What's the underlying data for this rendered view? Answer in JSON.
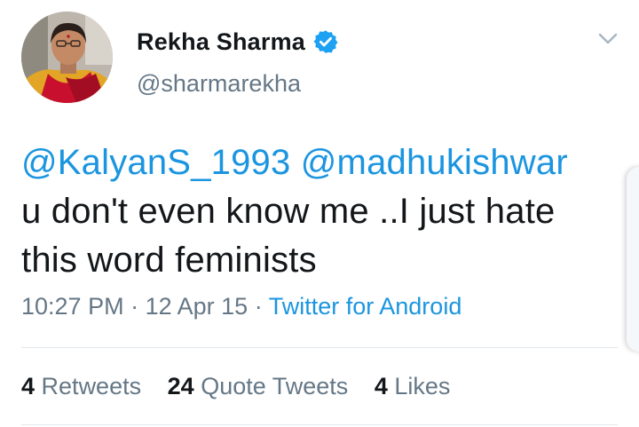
{
  "author": {
    "display_name": "Rekha Sharma",
    "handle": "@sharmarekha",
    "verified": true,
    "verified_icon": "verified-badge-icon",
    "verified_color": "#1da1f2"
  },
  "menu_icon": "chevron-down-icon",
  "tweet": {
    "mention_1": "@KalyanS_1993",
    "mention_2": "@madhukishwar",
    "text_line_1_rest": "u don't even know me ..I just hate",
    "text_line_2": "this word feminists"
  },
  "meta": {
    "time": "10:27 PM",
    "separator": "·",
    "date": "12 Apr 15",
    "source": "Twitter for Android"
  },
  "stats": {
    "retweets_count": "4",
    "retweets_label": "Retweets",
    "quote_count": "24",
    "quote_label": "Quote Tweets",
    "likes_count": "4",
    "likes_label": "Likes"
  },
  "colors": {
    "text": "#14171a",
    "secondary": "#657786",
    "link": "#1b95e0",
    "divider": "#e1e8ed"
  }
}
